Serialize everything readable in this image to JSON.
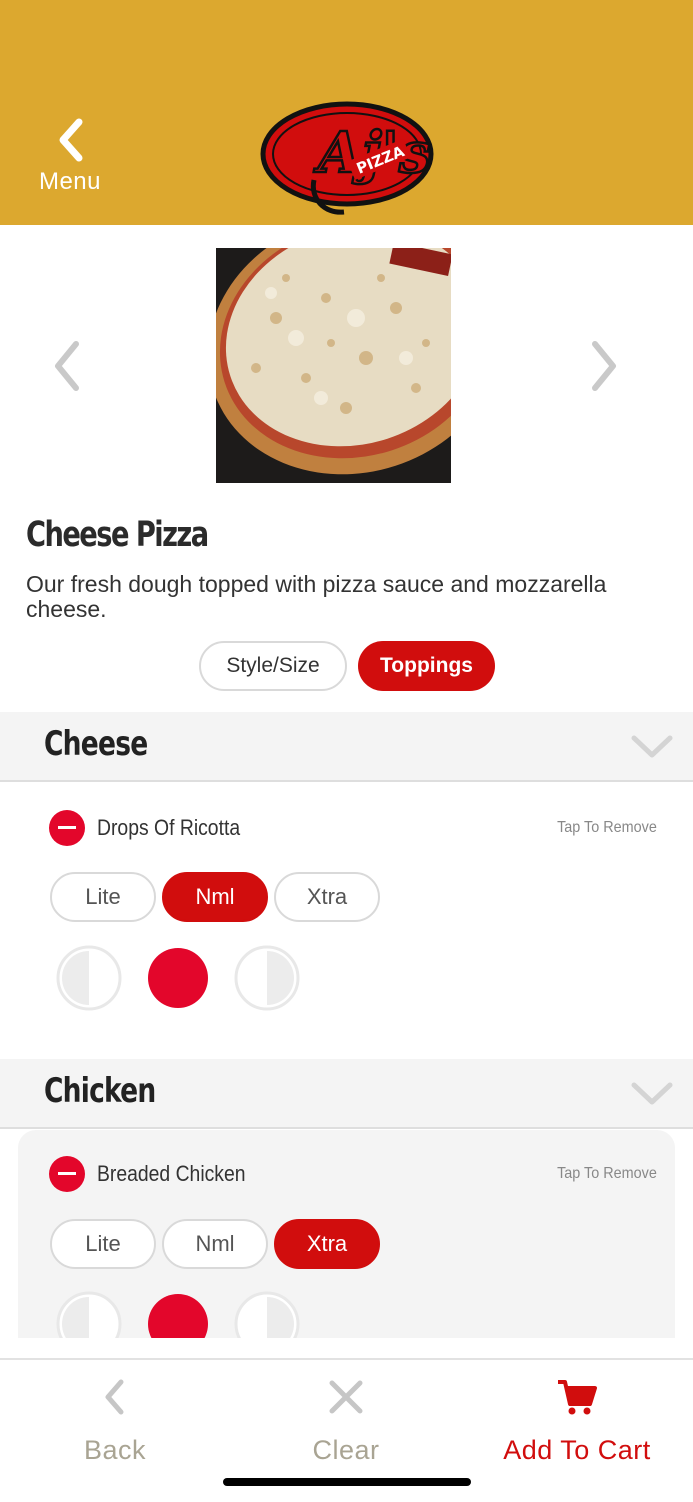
{
  "header": {
    "back_label": "Menu",
    "logo_text": "Aj's",
    "logo_subtext": "PIZZA"
  },
  "item": {
    "title": "Cheese Pizza",
    "description": "Our fresh dough topped with pizza sauce and mozzarella cheese."
  },
  "tabs": [
    {
      "label": "Style/Size",
      "selected": false
    },
    {
      "label": "Toppings",
      "selected": true
    }
  ],
  "sections": [
    {
      "title": "Cheese",
      "topping": {
        "name": "Drops Of Ricotta",
        "action": "Tap To Remove",
        "amounts": [
          "Lite",
          "Nml",
          "Xtra"
        ],
        "selected_amount": "Nml",
        "coverage": "whole"
      }
    },
    {
      "title": "Chicken",
      "topping": {
        "name": "Breaded Chicken",
        "action": "Tap To Remove",
        "amounts": [
          "Lite",
          "Nml",
          "Xtra"
        ],
        "selected_amount": "Xtra",
        "coverage": "whole"
      }
    }
  ],
  "bottom_bar": {
    "back": "Back",
    "clear": "Clear",
    "add_to_cart": "Add To Cart"
  },
  "colors": {
    "header": "#DCA82F",
    "accent": "#D10D0D",
    "remove": "#E3062B",
    "muted": "#a9a493"
  }
}
